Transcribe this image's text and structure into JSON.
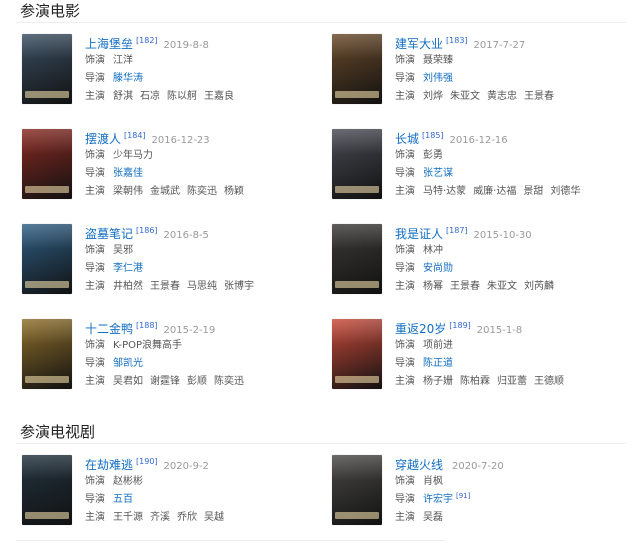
{
  "sections": {
    "movies_title": "参演电影",
    "tv_title": "参演电视剧"
  },
  "labels": {
    "role": "饰演",
    "director": "导演",
    "cast": "主演"
  },
  "movies": [
    {
      "title": "上海堡垒",
      "ref": "[182]",
      "date": "2019-8-8",
      "role": "江洋",
      "director": "滕华涛",
      "cast": [
        "舒淇",
        "石凉",
        "陈以舸",
        "王嘉良"
      ],
      "poster": "#3a4f63"
    },
    {
      "title": "建军大业",
      "ref": "[183]",
      "date": "2017-7-27",
      "role": "聂荣臻",
      "director": "刘伟强",
      "cast": [
        "刘烨",
        "朱亚文",
        "黄志忠",
        "王景春"
      ],
      "poster": "#6a4a2a"
    },
    {
      "title": "摆渡人",
      "ref": "[184]",
      "date": "2016-12-23",
      "role": "少年马力",
      "director": "张嘉佳",
      "cast": [
        "梁朝伟",
        "金城武",
        "陈奕迅",
        "杨颖"
      ],
      "poster": "#8a2a22"
    },
    {
      "title": "长城",
      "ref": "[185]",
      "date": "2016-12-16",
      "role": "彭勇",
      "director": "张艺谋",
      "cast": [
        "马特·达蒙",
        "威廉·达福",
        "景甜",
        "刘德华"
      ],
      "poster": "#4a4c55"
    },
    {
      "title": "盗墓笔记",
      "ref": "[186]",
      "date": "2016-8-5",
      "role": "吴邪",
      "director": "李仁港",
      "cast": [
        "井柏然",
        "王景春",
        "马思纯",
        "张博宇"
      ],
      "poster": "#2f5f86"
    },
    {
      "title": "我是证人",
      "ref": "[187]",
      "date": "2015-10-30",
      "role": "林冲",
      "director": "安尚勋",
      "cast": [
        "杨幂",
        "王景春",
        "朱亚文",
        "刘芮麟"
      ],
      "poster": "#3d3b38"
    },
    {
      "title": "十二金鸭",
      "ref": "[188]",
      "date": "2015-2-19",
      "role": "K-POP浪舞高手",
      "director": "邹凯光",
      "cast": [
        "吴君如",
        "谢霆锋",
        "彭顺",
        "陈奕迅"
      ],
      "poster": "#8f6f2a"
    },
    {
      "title": "重返20岁",
      "ref": "[189]",
      "date": "2015-1-8",
      "role": "项前进",
      "director": "陈正道",
      "cast": [
        "杨子姗",
        "陈柏霖",
        "归亚蕾",
        "王德顺"
      ],
      "poster": "#c94a3a"
    }
  ],
  "tv": [
    {
      "title": "在劫难逃",
      "ref": "[190]",
      "date": "2020-9-2",
      "role": "赵彬彬",
      "director": "五百",
      "cast": [
        "王千源",
        "齐溪",
        "乔欣",
        "吴越"
      ],
      "poster": "#223340"
    },
    {
      "title": "穿越火线",
      "ref": "",
      "date": "2020-7-20",
      "role": "肖枫",
      "director": "许宏宇",
      "director_ref": "[91]",
      "cast": [
        "吴磊"
      ],
      "poster": "#4b4a48"
    }
  ]
}
